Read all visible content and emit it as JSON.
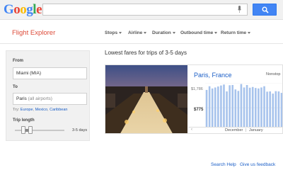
{
  "header": {
    "logo_letters": [
      "G",
      "o",
      "o",
      "g",
      "l",
      "e"
    ],
    "logo_colors": [
      "#4285f4",
      "#ea4335",
      "#fbbc05",
      "#4285f4",
      "#34a853",
      "#ea4335"
    ],
    "mic_icon": "microphone-icon",
    "search_icon": "magnifier-icon"
  },
  "app": {
    "title": "Flight Explorer",
    "accent": "#dd4b39"
  },
  "filters": [
    {
      "label": "Stops"
    },
    {
      "label": "Airline"
    },
    {
      "label": "Duration"
    },
    {
      "label": "Outbound time"
    },
    {
      "label": "Return time"
    }
  ],
  "sidebar": {
    "from_label": "From",
    "from_value": "Miami (MIA)",
    "to_label": "To",
    "to_value": "Paris",
    "to_suffix": "(all airports)",
    "try_prefix": "Try:",
    "try_links": [
      "Europe",
      "Mexico",
      "Caribbean"
    ],
    "trip_length_label": "Trip length",
    "trip_length_value": "3-5 days"
  },
  "results": {
    "heading": "Lowest fares for trips of 3-5 days",
    "destination": "Paris, France",
    "nonstop_label": "Nonstop",
    "price_high": "$1,786",
    "price_low": "$775",
    "month_a": "December",
    "month_b": "January",
    "bar_color": "#a7c3ec",
    "fares": [
      1500,
      1650,
      1560,
      1600,
      1640,
      1680,
      1720,
      1440,
      1690,
      1700,
      1520,
      1460,
      1740,
      1600,
      1700,
      1590,
      1620,
      1580,
      1560,
      1600,
      1650,
      1430,
      1440,
      1350,
      1450,
      1440,
      1380
    ]
  },
  "footer": {
    "search_help": "Search Help",
    "feedback": "Give us feedback"
  }
}
